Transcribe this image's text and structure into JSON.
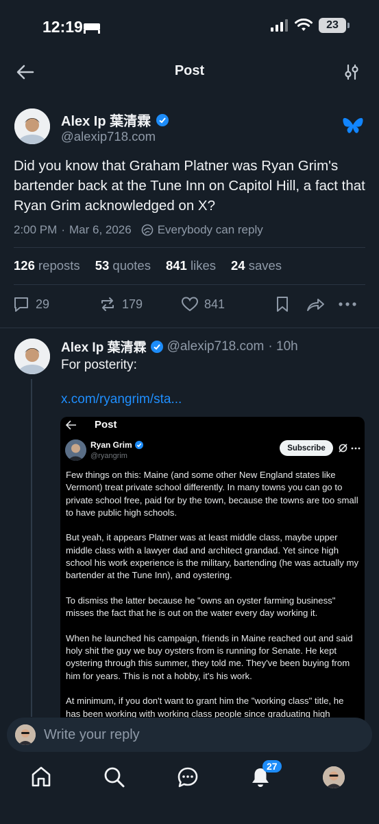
{
  "status_bar": {
    "time": "12:19",
    "battery": "23"
  },
  "header": {
    "title": "Post"
  },
  "post": {
    "author_name": "Alex Ip 葉清霖",
    "handle": "@alexip718.com",
    "text": "Did you know that Graham Platner was Ryan Grim's bartender back at the Tune Inn on Capitol Hill, a fact that Ryan Grim acknowledged on X?",
    "time": "2:00 PM",
    "date": "Mar 6, 2026",
    "reply_setting": "Everybody can reply",
    "stats": {
      "reposts_count": "126",
      "reposts_label": "reposts",
      "quotes_count": "53",
      "quotes_label": "quotes",
      "likes_count": "841",
      "likes_label": "likes",
      "saves_count": "24",
      "saves_label": "saves"
    },
    "actions": {
      "replies": "29",
      "reposts": "179",
      "likes": "841"
    }
  },
  "reply": {
    "author_name": "Alex Ip 葉清霖",
    "handle": "@alexip718.com",
    "age": "· 10h",
    "text": "For posterity:",
    "link": "x.com/ryangrim/sta...",
    "embed": {
      "header_title": "Post",
      "author_name": "Ryan Grim",
      "handle": "@ryangrim",
      "subscribe_label": "Subscribe",
      "paragraphs": [
        "Few things on this: Maine (and some other New England states like Vermont) treat private school differently. In many towns you can go to private school free, paid for by the town, because the towns are too small to have public high schools.",
        "But yeah, it appears Platner was at least middle class, maybe upper middle class with a lawyer dad and architect grandad. Yet since high school his work experience is the military, bartending (he was actually my bartender at the Tune Inn), and oystering.",
        "To dismiss the latter because he \"owns an oyster farming business\" misses the fact that he is out on the water every day working it.",
        "When he launched his campaign, friends in Maine reached out and said holy shit the guy we buy oysters from is running for Senate. He kept oystering through this summer, they told me. They've been buying from him for years. This is not a hobby, it's his work.",
        "At minimum, if you don't want to grant him the \"working class\" title, he has been working with working class people since graduating high"
      ]
    }
  },
  "composer": {
    "placeholder": "Write your reply"
  },
  "tabbar": {
    "notifications_badge": "27"
  },
  "colors": {
    "background": "#161e27",
    "accent": "#1d8cf8",
    "muted": "#8f9aa8",
    "link": "#1f8fff"
  }
}
